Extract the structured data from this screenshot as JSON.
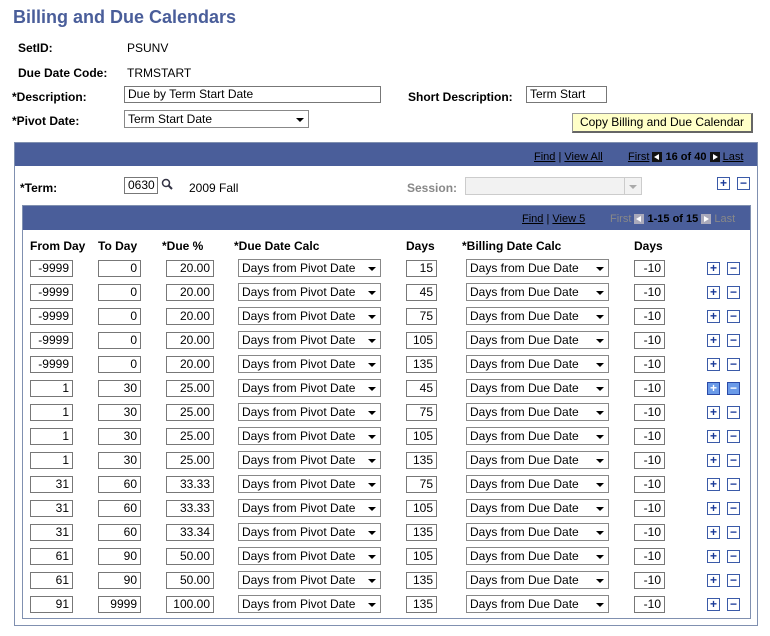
{
  "page": {
    "title": "Billing and Due Calendars"
  },
  "header": {
    "setid_label": "SetID:",
    "setid_value": "PSUNV",
    "duecode_label": "Due Date Code:",
    "duecode_value": "TRMSTART",
    "description_label": "*Description:",
    "description_value": "Due by Term Start Date",
    "short_desc_label": "Short Description:",
    "short_desc_value": "Term Start",
    "pivot_label": "*Pivot Date:",
    "pivot_value": "Term Start Date",
    "copy_button": "Copy Billing and Due Calendar"
  },
  "term_nav": {
    "find": "Find",
    "view_all": "View All",
    "first": "First",
    "position": "16 of 40",
    "last": "Last"
  },
  "term": {
    "label": "*Term:",
    "code": "0630",
    "name": "2009 Fall",
    "session_label": "Session:",
    "session_value": ""
  },
  "grid_nav": {
    "find": "Find",
    "view": "View 5",
    "first": "First",
    "position": "1-15 of 15",
    "last": "Last"
  },
  "columns": {
    "from_day": "From Day",
    "to_day": "To Day",
    "due_pct": "*Due %",
    "due_calc": "*Due Date Calc",
    "days": "Days",
    "billing_calc": "*Billing Date Calc",
    "days2": "Days"
  },
  "rows": [
    {
      "from": "-9999",
      "to": "0",
      "pct": "20.00",
      "calc": "Days from Pivot Date",
      "days": "15",
      "bcalc": "Days from Due Date",
      "bdays": "-10"
    },
    {
      "from": "-9999",
      "to": "0",
      "pct": "20.00",
      "calc": "Days from Pivot Date",
      "days": "45",
      "bcalc": "Days from Due Date",
      "bdays": "-10"
    },
    {
      "from": "-9999",
      "to": "0",
      "pct": "20.00",
      "calc": "Days from Pivot Date",
      "days": "75",
      "bcalc": "Days from Due Date",
      "bdays": "-10"
    },
    {
      "from": "-9999",
      "to": "0",
      "pct": "20.00",
      "calc": "Days from Pivot Date",
      "days": "105",
      "bcalc": "Days from Due Date",
      "bdays": "-10"
    },
    {
      "from": "-9999",
      "to": "0",
      "pct": "20.00",
      "calc": "Days from Pivot Date",
      "days": "135",
      "bcalc": "Days from Due Date",
      "bdays": "-10"
    },
    {
      "from": "1",
      "to": "30",
      "pct": "25.00",
      "calc": "Days from Pivot Date",
      "days": "45",
      "bcalc": "Days from Due Date",
      "bdays": "-10"
    },
    {
      "from": "1",
      "to": "30",
      "pct": "25.00",
      "calc": "Days from Pivot Date",
      "days": "75",
      "bcalc": "Days from Due Date",
      "bdays": "-10"
    },
    {
      "from": "1",
      "to": "30",
      "pct": "25.00",
      "calc": "Days from Pivot Date",
      "days": "105",
      "bcalc": "Days from Due Date",
      "bdays": "-10"
    },
    {
      "from": "1",
      "to": "30",
      "pct": "25.00",
      "calc": "Days from Pivot Date",
      "days": "135",
      "bcalc": "Days from Due Date",
      "bdays": "-10"
    },
    {
      "from": "31",
      "to": "60",
      "pct": "33.33",
      "calc": "Days from Pivot Date",
      "days": "75",
      "bcalc": "Days from Due Date",
      "bdays": "-10"
    },
    {
      "from": "31",
      "to": "60",
      "pct": "33.33",
      "calc": "Days from Pivot Date",
      "days": "105",
      "bcalc": "Days from Due Date",
      "bdays": "-10"
    },
    {
      "from": "31",
      "to": "60",
      "pct": "33.34",
      "calc": "Days from Pivot Date",
      "days": "135",
      "bcalc": "Days from Due Date",
      "bdays": "-10"
    },
    {
      "from": "61",
      "to": "90",
      "pct": "50.00",
      "calc": "Days from Pivot Date",
      "days": "105",
      "bcalc": "Days from Due Date",
      "bdays": "-10"
    },
    {
      "from": "61",
      "to": "90",
      "pct": "50.00",
      "calc": "Days from Pivot Date",
      "days": "135",
      "bcalc": "Days from Due Date",
      "bdays": "-10"
    },
    {
      "from": "91",
      "to": "9999",
      "pct": "100.00",
      "calc": "Days from Pivot Date",
      "days": "135",
      "bcalc": "Days from Due Date",
      "bdays": "-10"
    }
  ],
  "icons": {
    "add": "+",
    "remove": "−"
  },
  "colors": {
    "title": "#4a5e9a",
    "bar": "#4a5e9a",
    "button_bg": "#ffffc8"
  }
}
